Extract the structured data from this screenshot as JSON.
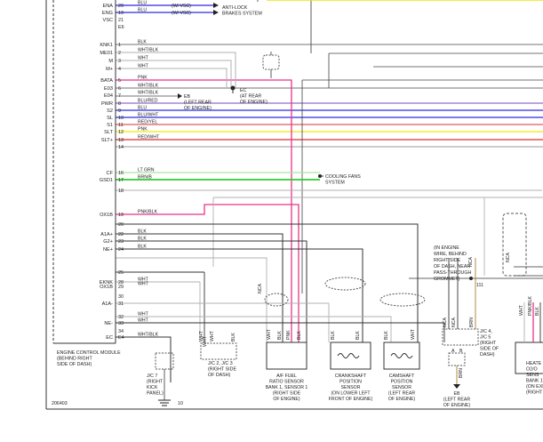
{
  "colors": {
    "pink": "#e8338a",
    "red": "#d93030",
    "green": "#2ecc2e",
    "yellow": "#f2e600",
    "blue": "#2a2ae0",
    "light_green": "#a8e6a0",
    "gray": "#b0b0b0",
    "black": "#2a2a2a",
    "purple": "#7a4ab8"
  },
  "icons": {
    "ground": "ground-symbol-icon",
    "connector": "inline-connector-icon",
    "sensor_coil": "sensor-coil-icon"
  },
  "ecm": {
    "label_lines": [
      "ENGINE CONTROL MODULE",
      "(BEHIND RIGHT",
      "SIDE OF DASH)"
    ],
    "pins": [
      {
        "name": "ENA",
        "num": "20",
        "wire": "BLU",
        "note": "(W/ VSC)"
      },
      {
        "name": "ENG",
        "num": "19",
        "wire": "BLU",
        "note": "(W/ VSC)"
      },
      {
        "name": "VSC",
        "num": "21",
        "wire": "",
        "note": ""
      },
      {
        "name": "",
        "num": "E6",
        "wire": "",
        "note": ""
      },
      {
        "name": "KNK1",
        "num": "1",
        "wire": "BLK",
        "note": ""
      },
      {
        "name": "ME01",
        "num": "2",
        "wire": "WHT/BLK",
        "note": ""
      },
      {
        "name": "M",
        "num": "3",
        "wire": "WHT",
        "note": ""
      },
      {
        "name": "M+",
        "num": "4",
        "wire": "WHT",
        "note": ""
      },
      {
        "name": "BATA",
        "num": "5",
        "wire": "PNK",
        "note": ""
      },
      {
        "name": "E03",
        "num": "6",
        "wire": "WHT/BLK",
        "note": ""
      },
      {
        "name": "E04",
        "num": "7",
        "wire": "WHT/BLK",
        "note": ""
      },
      {
        "name": "PWR",
        "num": "8",
        "wire": "BLU/RED",
        "note": ""
      },
      {
        "name": "S2",
        "num": "9",
        "wire": "BLU",
        "note": ""
      },
      {
        "name": "SL",
        "num": "10",
        "wire": "BLU/WHT",
        "note": ""
      },
      {
        "name": "S1",
        "num": "11",
        "wire": "RED/YEL",
        "note": ""
      },
      {
        "name": "SLT",
        "num": "12",
        "wire": "PNK",
        "note": ""
      },
      {
        "name": "SLT+",
        "num": "13",
        "wire": "RED/WHT",
        "note": ""
      },
      {
        "name": "",
        "num": "14",
        "wire": "",
        "note": ""
      },
      {
        "name": "CF",
        "num": "16",
        "wire": "LT GRN",
        "note": ""
      },
      {
        "name": "GSD1",
        "num": "17",
        "wire": "BRN/B",
        "note": ""
      },
      {
        "name": "",
        "num": "18",
        "wire": "",
        "note": ""
      },
      {
        "name": "OX1B",
        "num": "19",
        "wire": "PNK/BLK",
        "note": ""
      },
      {
        "name": "",
        "num": "20",
        "wire": "",
        "note": ""
      },
      {
        "name": "A1A+",
        "num": "22",
        "wire": "BLK",
        "note": ""
      },
      {
        "name": "G2+",
        "num": "23",
        "wire": "BLK",
        "note": ""
      },
      {
        "name": "NE+",
        "num": "24",
        "wire": "BLK",
        "note": ""
      },
      {
        "name": "",
        "num": "25",
        "wire": "",
        "note": ""
      },
      {
        "name": "EKNK",
        "num": "28",
        "wire": "WHT",
        "note": ""
      },
      {
        "name": "OX1B",
        "num": "29",
        "wire": "WHT",
        "note": ""
      },
      {
        "name": "",
        "num": "30",
        "wire": "",
        "note": ""
      },
      {
        "name": "A1A-",
        "num": "31",
        "wire": "",
        "note": ""
      },
      {
        "name": "",
        "num": "32",
        "wire": "WHT",
        "note": ""
      },
      {
        "name": "NE-",
        "num": "33",
        "wire": "WHT",
        "note": ""
      },
      {
        "name": "",
        "num": "34",
        "wire": "",
        "note": ""
      },
      {
        "name": "EC",
        "num": "E4",
        "wire": "WHT/BLK",
        "note": ""
      }
    ]
  },
  "callouts": {
    "antilock": [
      "ANTI-LOCK",
      "BRAKES SYSTEM"
    ],
    "eb": [
      "EB",
      "(LEFT REAR",
      "OF ENGINE)"
    ],
    "ec": [
      "EC",
      "(AT REAR",
      "OF ENGINE)"
    ],
    "cooling": [
      "COOLING FANS",
      "SYSTEM"
    ],
    "grommet": [
      "(IN ENGINE",
      "WIRE, BEHIND",
      "RIGHT SIDE",
      "OF DASH, NEAR",
      "PASS-THROUGH",
      "GROMMET)"
    ],
    "nca_top": "NCA",
    "nca_right": "NCA",
    "nca_mid": "NCA",
    "nca_top_right": "NCA",
    "pin_111": "111"
  },
  "junctions": {
    "jc7": [
      "J/C 7",
      "(RIGHT",
      "KICK",
      "PANEL)"
    ],
    "jc23": [
      "J/C 2, J/C 3",
      "(RIGHT SIDE",
      "OF DASH)"
    ],
    "jc45": [
      "J/C 4,",
      "J/C 5",
      "(RIGHT",
      "SIDE OF",
      "DASH)"
    ],
    "ground_num": "10"
  },
  "components": [
    {
      "id": "af",
      "lines": [
        "A/F FUEL",
        "RATIO SENSOR",
        "BANK 1, SENSOR 1",
        "(RIGHT SIDE",
        "OF ENGINE)"
      ]
    },
    {
      "id": "crank",
      "lines": [
        "CRANKSHAFT",
        "POSITION",
        "SENSOR",
        "(ON LOWER LEFT",
        "FRONT OF ENGINE)"
      ]
    },
    {
      "id": "cam",
      "lines": [
        "CAMSHAFT",
        "POSITION",
        "SENSOR",
        "(LEFT REAR",
        "OF ENGINE)"
      ]
    },
    {
      "id": "eb2",
      "lines": [
        "EB",
        "(LEFT REAR",
        "OF ENGINE)"
      ]
    },
    {
      "id": "heated",
      "lines": [
        "HEATE",
        "O2/O",
        "SENS",
        "BANK 1, SE",
        "(ON EXH AU",
        "(RIGHT SIDE"
      ]
    }
  ],
  "vertical_wire_labels": {
    "jc7_wires": [
      "WHT"
    ],
    "jc23_wires": [
      "WHT",
      "WHT",
      "BLK"
    ],
    "af_wires": [
      "WHT",
      "BLK",
      "PNK",
      "BLK"
    ],
    "crank_wires": [
      "BLK",
      "BLK"
    ],
    "cam_wires": [
      "BLK",
      "WHT"
    ],
    "eb2_wires": [
      "NCA",
      "NCA",
      "BRN"
    ],
    "heated_wires": [
      "WHT",
      "PNK/BLK",
      "BLK"
    ],
    "eb2_pins": [
      "A",
      "B"
    ],
    "eb2_stub": "BRN"
  },
  "footer_code": "206403"
}
